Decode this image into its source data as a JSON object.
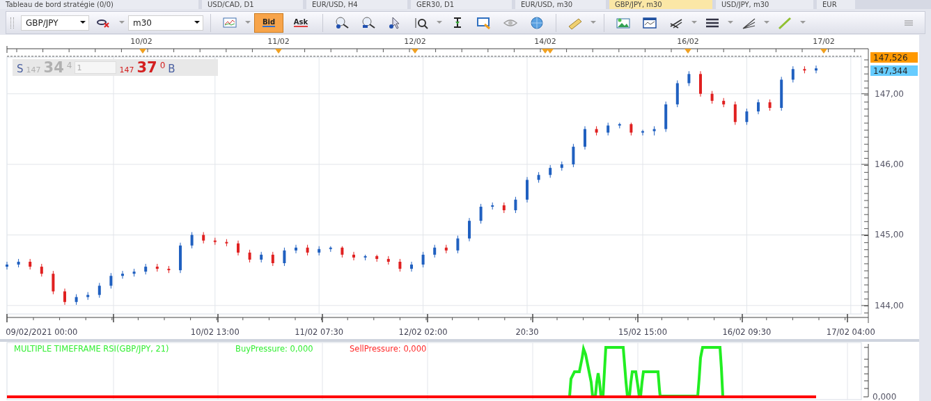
{
  "tabs": [
    {
      "label": "Tableau de bord stratégie (0/0)",
      "selected": false
    },
    {
      "label": "USD/CAD, D1",
      "selected": false
    },
    {
      "label": "EUR/USD, H4",
      "selected": false
    },
    {
      "label": "GER30, D1",
      "selected": false
    },
    {
      "label": "EUR/USD, m30",
      "selected": false
    },
    {
      "label": "GBP/JPY, m30",
      "selected": true
    },
    {
      "label": "USD/JPY, m30",
      "selected": false
    },
    {
      "label": "EUR",
      "selected": false
    }
  ],
  "toolbar": {
    "symbol": "GBP/JPY",
    "timeframe": "m30",
    "price_buttons": [
      {
        "label": "Bid",
        "selected": true
      },
      {
        "label": "Ask",
        "selected": false
      }
    ]
  },
  "date_ruler": {
    "labels": [
      "10/02",
      "11/02",
      "12/02",
      "14/02",
      "16/02",
      "17/02"
    ]
  },
  "quote": {
    "sell_label": "S",
    "sell_prefix": "147",
    "sell_big": "34",
    "sell_pip": "4",
    "amount": "1",
    "buy_prefix": "147",
    "buy_big": "37",
    "buy_pip": "0",
    "buy_label": "B"
  },
  "price_chart": {
    "chart_data": {
      "type": "candlestick",
      "grid": true,
      "ylim": [
        143.88,
        147.52
      ],
      "categories": [
        null,
        null,
        null,
        "09/02/2021 00:00",
        null,
        null,
        null,
        null,
        null,
        null,
        null,
        null,
        null,
        null,
        null,
        null,
        null,
        null,
        "10/02 13:00",
        null,
        null,
        null,
        null,
        null,
        null,
        null,
        null,
        "11/02 07:30",
        null,
        null,
        null,
        null,
        null,
        null,
        null,
        null,
        "12/02 02:00",
        null,
        null,
        null,
        null,
        null,
        null,
        null,
        null,
        "20:30",
        null,
        null,
        null,
        null,
        null,
        null,
        null,
        null,
        null,
        "15/02 15:00",
        null,
        null,
        null,
        null,
        null,
        null,
        null,
        null,
        "16/02 09:30",
        null,
        null,
        null,
        null,
        null,
        null,
        null,
        null,
        "17/02 04:00"
      ],
      "yticks": [
        {
          "value": 144,
          "label": "144,00"
        },
        {
          "value": 145,
          "label": "145,00"
        },
        {
          "value": 146,
          "label": "146,00"
        },
        {
          "value": 147,
          "label": "147,00"
        }
      ],
      "ohlc": [
        [
          144.55,
          144.62,
          144.51,
          144.58
        ],
        [
          144.58,
          144.66,
          144.54,
          144.62
        ],
        [
          144.62,
          144.66,
          144.51,
          144.55
        ],
        [
          144.55,
          144.59,
          144.41,
          144.45
        ],
        [
          144.45,
          144.49,
          144.16,
          144.2
        ],
        [
          144.2,
          144.24,
          144.01,
          144.05
        ],
        [
          144.05,
          144.16,
          144.01,
          144.12
        ],
        [
          144.12,
          144.19,
          144.08,
          144.15
        ],
        [
          144.15,
          144.32,
          144.11,
          144.28
        ],
        [
          144.28,
          144.46,
          144.24,
          144.42
        ],
        [
          144.42,
          144.49,
          144.38,
          144.45
        ],
        [
          144.45,
          144.52,
          144.41,
          144.48
        ],
        [
          144.48,
          144.59,
          144.44,
          144.55
        ],
        [
          144.55,
          144.59,
          144.48,
          144.52
        ],
        [
          144.52,
          144.56,
          144.46,
          144.5
        ],
        [
          144.5,
          144.89,
          144.46,
          144.85
        ],
        [
          144.85,
          145.04,
          144.81,
          145.0
        ],
        [
          145.0,
          145.04,
          144.88,
          144.92
        ],
        [
          144.92,
          144.96,
          144.86,
          144.9
        ],
        [
          144.9,
          144.94,
          144.84,
          144.88
        ],
        [
          144.88,
          144.92,
          144.71,
          144.75
        ],
        [
          144.75,
          144.79,
          144.61,
          144.65
        ],
        [
          144.65,
          144.76,
          144.61,
          144.72
        ],
        [
          144.72,
          144.76,
          144.56,
          144.6
        ],
        [
          144.6,
          144.82,
          144.56,
          144.78
        ],
        [
          144.78,
          144.86,
          144.74,
          144.82
        ],
        [
          144.82,
          144.86,
          144.71,
          144.75
        ],
        [
          144.75,
          144.84,
          144.71,
          144.8
        ],
        [
          144.8,
          144.84,
          144.76,
          144.82
        ],
        [
          144.82,
          144.84,
          144.68,
          144.72
        ],
        [
          144.72,
          144.76,
          144.64,
          144.68
        ],
        [
          144.68,
          144.72,
          144.64,
          144.7
        ],
        [
          144.7,
          144.72,
          144.62,
          144.66
        ],
        [
          144.66,
          144.7,
          144.58,
          144.62
        ],
        [
          144.62,
          144.66,
          144.48,
          144.52
        ],
        [
          144.52,
          144.62,
          144.48,
          144.58
        ],
        [
          144.58,
          144.76,
          144.54,
          144.72
        ],
        [
          144.72,
          144.86,
          144.68,
          144.82
        ],
        [
          144.82,
          144.86,
          144.74,
          144.78
        ],
        [
          144.78,
          144.99,
          144.74,
          144.95
        ],
        [
          144.95,
          145.24,
          144.91,
          145.2
        ],
        [
          145.2,
          145.44,
          145.16,
          145.4
        ],
        [
          145.4,
          145.46,
          145.36,
          145.42
        ],
        [
          145.42,
          145.46,
          145.31,
          145.35
        ],
        [
          145.35,
          145.54,
          145.31,
          145.5
        ],
        [
          145.5,
          145.82,
          145.46,
          145.78
        ],
        [
          145.78,
          145.89,
          145.74,
          145.85
        ],
        [
          145.85,
          145.99,
          145.81,
          145.95
        ],
        [
          145.95,
          146.04,
          145.91,
          146.0
        ],
        [
          146.0,
          146.29,
          145.96,
          146.25
        ],
        [
          146.25,
          146.54,
          146.21,
          146.5
        ],
        [
          146.5,
          146.54,
          146.41,
          146.45
        ],
        [
          146.45,
          146.59,
          146.41,
          146.55
        ],
        [
          146.55,
          146.59,
          146.51,
          146.57
        ],
        [
          146.57,
          146.59,
          146.41,
          146.45
        ],
        [
          146.45,
          146.49,
          146.41,
          146.47
        ],
        [
          146.47,
          146.54,
          146.41,
          146.5
        ],
        [
          146.5,
          146.89,
          146.46,
          146.85
        ],
        [
          146.85,
          147.19,
          146.81,
          147.15
        ],
        [
          147.15,
          147.32,
          147.11,
          147.28
        ],
        [
          147.28,
          147.32,
          146.96,
          147.0
        ],
        [
          147.0,
          147.04,
          146.86,
          146.9
        ],
        [
          146.9,
          146.94,
          146.81,
          146.85
        ],
        [
          146.85,
          146.89,
          146.56,
          146.6
        ],
        [
          146.6,
          146.79,
          146.56,
          146.75
        ],
        [
          146.75,
          146.92,
          146.71,
          146.88
        ],
        [
          146.88,
          146.92,
          146.76,
          146.8
        ],
        [
          146.8,
          147.24,
          146.76,
          147.2
        ],
        [
          147.2,
          147.39,
          147.16,
          147.35
        ],
        [
          147.35,
          147.39,
          147.29,
          147.33
        ],
        [
          147.33,
          147.4,
          147.29,
          147.36
        ],
        null,
        null,
        null
      ]
    },
    "price_tags": [
      {
        "value": "147,526",
        "color": "#ff9900"
      },
      {
        "value": "147,344",
        "color": "#66ccff"
      }
    ]
  },
  "indicator": {
    "title": "MULTIPLE TIMEFRAME RSI(GBP/JPY, 21)",
    "buy_pressure": "BuyPressure: 0,000",
    "sell_pressure": "SellPressure: 0,000",
    "axis_label": "0,000"
  }
}
